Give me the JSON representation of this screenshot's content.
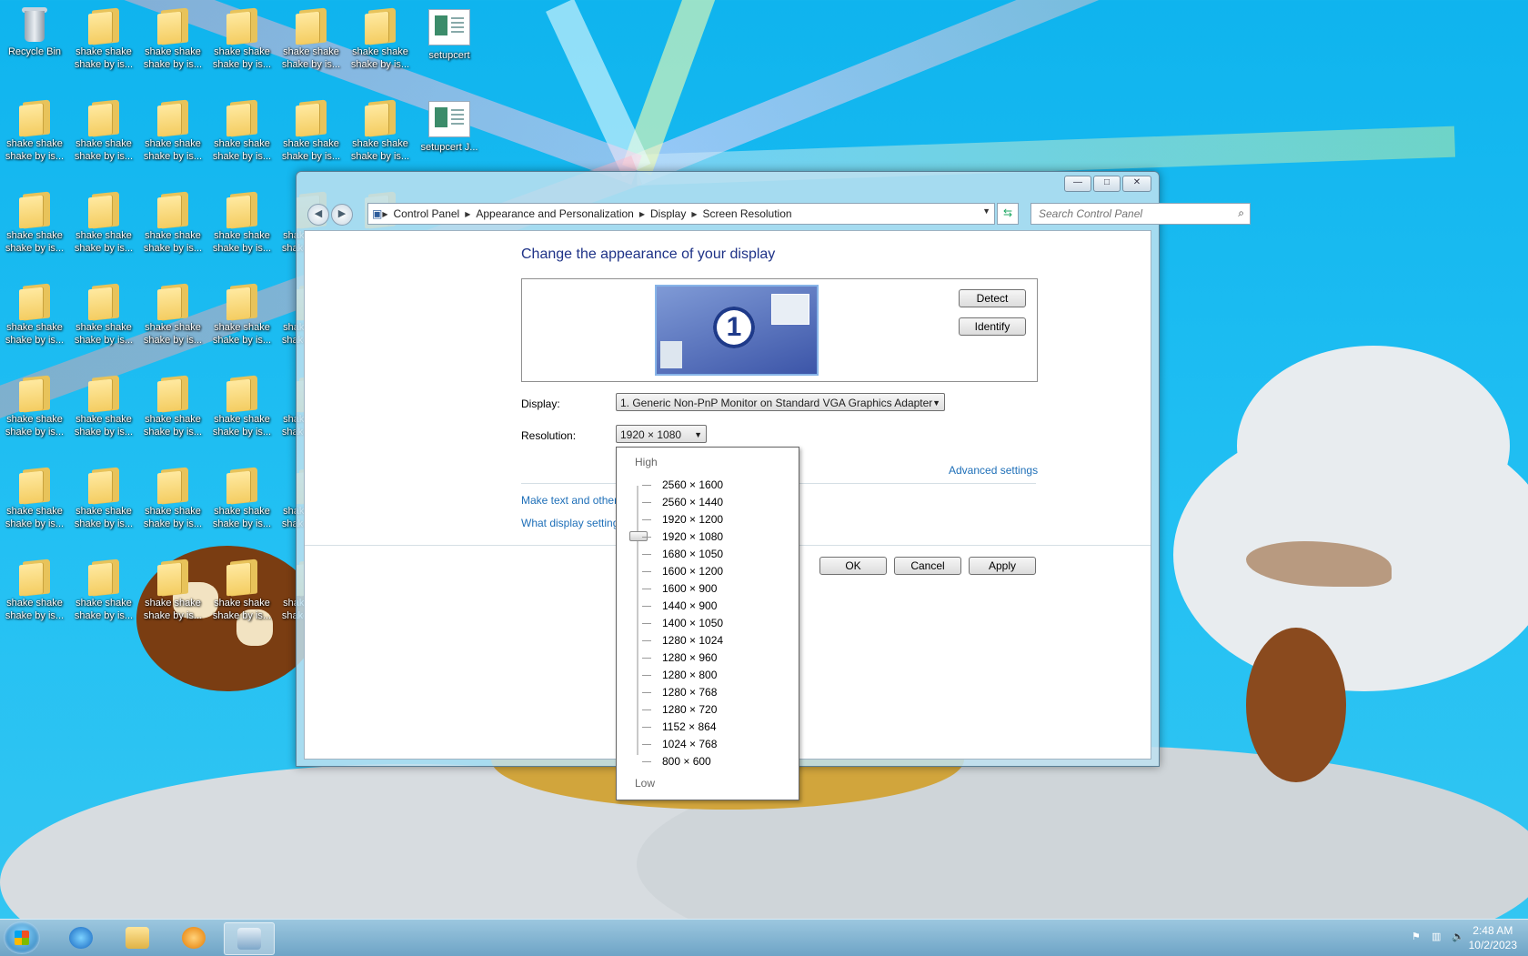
{
  "desktop": {
    "icon_labels": {
      "recycle_bin": "Recycle Bin",
      "folder_row1": [
        "shake shake",
        "shake by is..."
      ],
      "folder_line1": "shake shake",
      "folder_line2": "shake by is...",
      "setupcert": "setupcert",
      "setupcert2": "setupcert J..."
    }
  },
  "window": {
    "caption_buttons": {
      "minimize": "—",
      "maximize": "□",
      "close": "✕"
    },
    "breadcrumb": [
      "Control Panel",
      "Appearance and Personalization",
      "Display",
      "Screen Resolution"
    ],
    "search_placeholder": "Search Control Panel",
    "heading": "Change the appearance of your display",
    "monitor_number": "1",
    "detect_label": "Detect",
    "identify_label": "Identify",
    "display_label": "Display:",
    "display_value": "1. Generic Non-PnP Monitor on Standard VGA Graphics Adapter",
    "resolution_label": "Resolution:",
    "resolution_value": "1920 × 1080",
    "advanced_link": "Advanced settings",
    "make_text_link": "Make text and other",
    "what_display_link": "What display setting",
    "ok_label": "OK",
    "cancel_label": "Cancel",
    "apply_label": "Apply"
  },
  "resolution_dropdown": {
    "high_label": "High",
    "low_label": "Low",
    "options": [
      "2560 × 1600",
      "2560 × 1440",
      "1920 × 1200",
      "1920 × 1080",
      "1680 × 1050",
      "1600 × 1200",
      "1600 × 900",
      "1440 × 900",
      "1400 × 1050",
      "1280 × 1024",
      "1280 × 960",
      "1280 × 800",
      "1280 × 768",
      "1280 × 720",
      "1152 × 864",
      "1024 × 768",
      "800 × 600"
    ],
    "selected": "1920 × 1080"
  },
  "taskbar": {
    "clock_time": "2:48 AM",
    "clock_date": "10/2/2023",
    "icons": [
      "start-orb-icon",
      "internet-explorer-icon",
      "file-explorer-icon",
      "media-player-icon",
      "control-panel-icon"
    ]
  },
  "colors": {
    "sky": "#1cbcf2",
    "link": "#1e6fb8",
    "heading": "#1e3287"
  }
}
